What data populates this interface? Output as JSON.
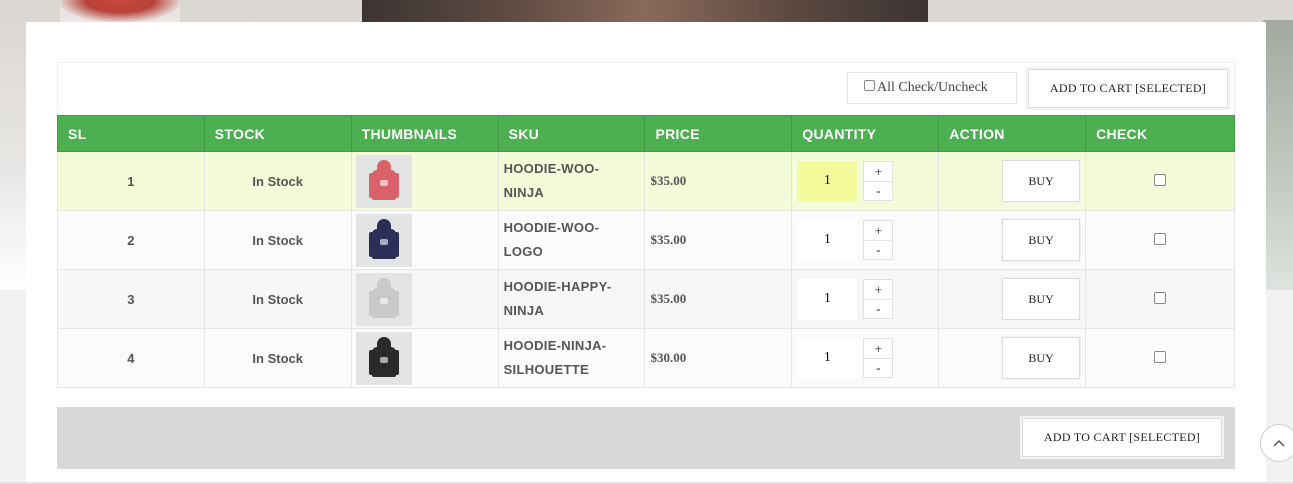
{
  "controls": {
    "check_all_label": "All Check/Uncheck",
    "add_to_cart_selected": "ADD TO CART [SELECTED]"
  },
  "table": {
    "headers": [
      "SL",
      "STOCK",
      "THUMBNAILS",
      "SKU",
      "PRICE",
      "QUANTITY",
      "ACTION",
      "CHECK"
    ],
    "rows": [
      {
        "sl": "1",
        "stock": "In Stock",
        "sku": "HOODIE-WOO-NINJA",
        "sku_line1": "HOODIE-WOO-",
        "sku_line2": "NINJA",
        "price": "$35.00",
        "quantity": "1",
        "buy": "BUY",
        "thumb_color": "#d9626a",
        "thumb_icon": "hoodie-icon"
      },
      {
        "sl": "2",
        "stock": "In Stock",
        "sku": "HOODIE-WOO-LOGO",
        "sku_line1": "HOODIE-WOO-",
        "sku_line2": "LOGO",
        "price": "$35.00",
        "quantity": "1",
        "buy": "BUY",
        "thumb_color": "#2b2f57",
        "thumb_icon": "hoodie-icon"
      },
      {
        "sl": "3",
        "stock": "In Stock",
        "sku": "HOODIE-HAPPY-NINJA",
        "sku_line1": "HOODIE-HAPPY-",
        "sku_line2": "NINJA",
        "price": "$35.00",
        "quantity": "1",
        "buy": "BUY",
        "thumb_color": "#c9c9c9",
        "thumb_icon": "hoodie-icon"
      },
      {
        "sl": "4",
        "stock": "In Stock",
        "sku": "HOODIE-NINJA-SILHOUETTE",
        "sku_line1": "HOODIE-NINJA-",
        "sku_line2": "SILHOUETTE",
        "price": "$30.00",
        "quantity": "1",
        "buy": "BUY",
        "thumb_color": "#2a2a2a",
        "thumb_icon": "hoodie-icon"
      }
    ],
    "qty_plus": "+",
    "qty_minus": "-"
  },
  "colors": {
    "header_green": "#4caf50",
    "stock_green": "#4caf50",
    "highlight_row": "#f4fbd9",
    "highlight_qty": "#f4fb9c"
  },
  "scroll_top_icon": "chevron-up-icon"
}
